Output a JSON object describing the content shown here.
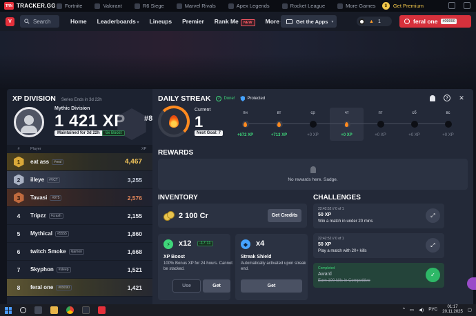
{
  "topbar": {
    "site_name": "TRACKER.GG",
    "logo_text": "TRN",
    "games": [
      "Fortnite",
      "Valorant",
      "R6 Siege",
      "Marvel Rivals",
      "Apex Legends",
      "Rocket League",
      "More Games"
    ],
    "premium_label": "Get Premium"
  },
  "nav": {
    "search_label": "Search",
    "links": {
      "home": "Home",
      "leaderboards": "Leaderboards",
      "lineups": "Lineups",
      "premier": "Premier",
      "rankme": "Rank Me",
      "more": "More"
    },
    "new_badge": "NEW",
    "get_apps": "Get the Apps",
    "streak_count": "1",
    "user_name": "feral one",
    "user_tag": "#09090"
  },
  "xp_division": {
    "title": "XP DIVISION",
    "series_note": "Series Ends in 3d 22h",
    "division": "Mythic Division",
    "xp": "1 421 XP",
    "rank": "#8",
    "maintained": "Maintained for 3d 22h",
    "boost": "6x Boost",
    "col_rank": "#",
    "col_player": "Player",
    "col_xp": "XP",
    "rows": [
      {
        "rank": "1",
        "name": "eat ass",
        "tag": "#real",
        "xp": "4,467"
      },
      {
        "rank": "2",
        "name": "illeye",
        "tag": "#VCT",
        "xp": "3,255"
      },
      {
        "rank": "3",
        "name": "Tavasi",
        "tag": "#975",
        "xp": "2,576"
      },
      {
        "rank": "4",
        "name": "Tripzz",
        "tag": "#crash",
        "xp": "2,155"
      },
      {
        "rank": "5",
        "name": "Mythical",
        "tag": "#5555",
        "xp": "1,860"
      },
      {
        "rank": "6",
        "name": "twitch Smoke",
        "tag": "#jamon",
        "xp": "1,668"
      },
      {
        "rank": "7",
        "name": "Skyphon",
        "tag": "#sleep",
        "xp": "1,521"
      },
      {
        "rank": "8",
        "name": "feral one",
        "tag": "#09090",
        "xp": "1,421"
      }
    ]
  },
  "daily_streak": {
    "title": "DAILY STREAK",
    "done": "Done!",
    "protected": "Protected",
    "current_label": "Current",
    "current_value": "1",
    "next_goal": "Next Goal: 7",
    "days": [
      {
        "name": "пн",
        "xp": "+672 XP",
        "gain": true,
        "on": true
      },
      {
        "name": "вт",
        "xp": "+713 XP",
        "gain": true,
        "on": true
      },
      {
        "name": "ср",
        "xp": "+0 XP",
        "gain": false,
        "on": false
      },
      {
        "name": "чт",
        "xp": "+0 XP",
        "gain": true,
        "on": true,
        "today": true
      },
      {
        "name": "пт",
        "xp": "+0 XP",
        "gain": false,
        "on": false
      },
      {
        "name": "сб",
        "xp": "+0 XP",
        "gain": false,
        "on": false
      },
      {
        "name": "вс",
        "xp": "+0 XP",
        "gain": false,
        "on": false
      }
    ]
  },
  "rewards": {
    "title": "REWARDS",
    "empty": "No rewards here. Sadge."
  },
  "inventory": {
    "title": "INVENTORY",
    "credits": "2 100 Cr",
    "get_credits": "Get Credits",
    "xp_boost": {
      "qty": "x12",
      "timer": "-17:11",
      "name": "XP Boost",
      "desc": "100% Bonus XP for 24 hours. Cannot be stacked.",
      "use": "Use",
      "get": "Get"
    },
    "streak_shield": {
      "qty": "x4",
      "name": "Streak Shield",
      "desc": "Automatically activated upon streak end.",
      "get": "Get"
    }
  },
  "challenges": {
    "title": "CHALLENGES",
    "items": [
      {
        "time": "22:42:52 // 0 of 1",
        "xp": "50 XP",
        "desc": "Win a match in under 20 mins"
      },
      {
        "time": "22:42:52 // 0 of 1",
        "xp": "50 XP",
        "desc": "Play a match with 20+ kills"
      },
      {
        "time": "Completed",
        "xp": "Award",
        "desc": "Earn 100 kills in Competitive"
      }
    ]
  },
  "taskbar": {
    "lang": "РУС",
    "time": "01:17",
    "date": "20.11.2025"
  },
  "colors": {
    "accent_red": "#d6313c",
    "gold": "#f0c35a",
    "green": "#3fd67a",
    "flame": "#ff8a1f"
  }
}
